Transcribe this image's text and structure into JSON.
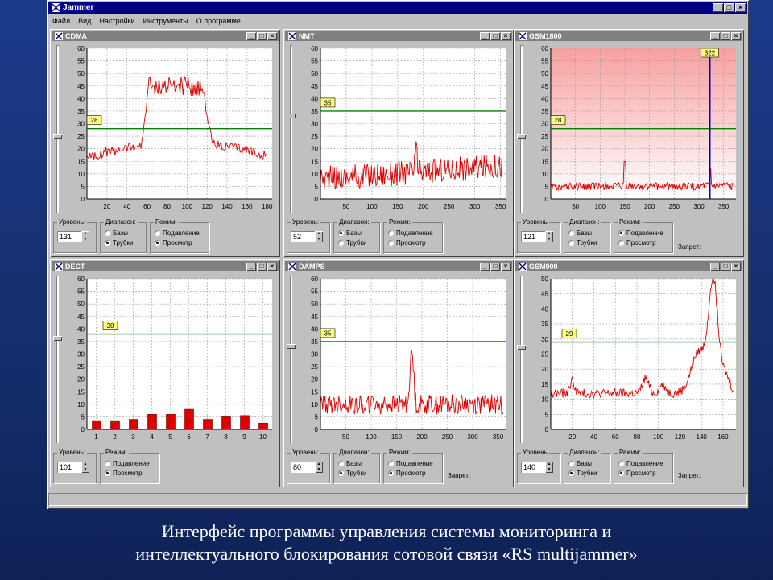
{
  "app": {
    "title": "Jammer"
  },
  "menu": [
    "Файл",
    "Вид",
    "Настройки",
    "Инструменты",
    "О программе"
  ],
  "labels": {
    "level": "Уровень:",
    "level_alt": "Уровень",
    "range": "Диапазон:",
    "mode": "Режим:",
    "bases": "Базы",
    "phones": "Трубки",
    "suppress": "Подавление",
    "view": "Просмотр",
    "ban": "Запрет:"
  },
  "colors": {
    "signal": "#dd0000",
    "threshold": "#008000",
    "alarm_bg": "#f7a0a0",
    "marker": "#0000cc"
  },
  "panels": [
    {
      "id": "cdma",
      "title": "CDMA",
      "level": "131",
      "range_sel": "phones",
      "mode_sel": "view",
      "chart_data": {
        "type": "line",
        "x_ticks": [
          "20",
          "40",
          "60",
          "80",
          "100",
          "120",
          "140",
          "160",
          "180"
        ],
        "y_ticks": [
          "0",
          "5",
          "10",
          "15",
          "20",
          "25",
          "30",
          "35",
          "40",
          "45",
          "50",
          "55",
          "60"
        ],
        "ylim": [
          0,
          60
        ],
        "xlim": [
          0,
          185
        ],
        "threshold": 28,
        "threshold_label": "28"
      }
    },
    {
      "id": "nmt",
      "title": "NMT",
      "level": "52",
      "range_sel": "bases",
      "mode_sel": "none",
      "chart_data": {
        "type": "line",
        "x_ticks": [
          "50",
          "100",
          "150",
          "200",
          "250",
          "300",
          "350"
        ],
        "y_ticks": [
          "0",
          "5",
          "10",
          "15",
          "20",
          "25",
          "30",
          "35",
          "40",
          "45",
          "50",
          "55",
          "60"
        ],
        "ylim": [
          0,
          60
        ],
        "xlim": [
          0,
          360
        ],
        "threshold": 35,
        "threshold_label": "35"
      }
    },
    {
      "id": "gsm1800",
      "title": "GSM1800",
      "level": "121",
      "range_sel": "none",
      "mode_sel": "suppress",
      "chart_data": {
        "type": "line",
        "x_ticks": [
          "50",
          "100",
          "150",
          "200",
          "250",
          "300",
          "350"
        ],
        "y_ticks": [
          "0",
          "5",
          "10",
          "15",
          "20",
          "25",
          "30",
          "35",
          "40",
          "45",
          "50",
          "55",
          "60"
        ],
        "ylim": [
          0,
          60
        ],
        "xlim": [
          0,
          375
        ],
        "threshold": 28,
        "threshold_label": "28",
        "marker_x": 322,
        "marker_label": "322"
      }
    },
    {
      "id": "dect",
      "title": "DECT",
      "level": "101",
      "mode_sel": "view",
      "chart_data": {
        "type": "bar",
        "categories": [
          "1",
          "2",
          "3",
          "4",
          "5",
          "6",
          "7",
          "8",
          "9",
          "10"
        ],
        "values": [
          3.5,
          3.5,
          4,
          6,
          6,
          8,
          4,
          5,
          5.5,
          2.5
        ],
        "y_ticks": [
          "0",
          "5",
          "10",
          "15",
          "20",
          "25",
          "30",
          "35",
          "40",
          "45",
          "50",
          "55",
          "60"
        ],
        "ylim": [
          0,
          60
        ],
        "threshold": 38,
        "threshold_label": "38"
      }
    },
    {
      "id": "damps",
      "title": "DAMPS",
      "level": "80",
      "range_sel": "phones",
      "mode_sel": "view",
      "chart_data": {
        "type": "line",
        "x_ticks": [
          "50",
          "100",
          "150",
          "200",
          "250",
          "300",
          "350"
        ],
        "y_ticks": [
          "0",
          "5",
          "10",
          "15",
          "20",
          "25",
          "30",
          "35",
          "40",
          "45",
          "50",
          "55",
          "60"
        ],
        "ylim": [
          0,
          60
        ],
        "xlim": [
          0,
          365
        ],
        "threshold": 35,
        "threshold_label": "35"
      }
    },
    {
      "id": "gsm900",
      "title": "GSM900",
      "level": "140",
      "range_sel": "phones",
      "mode_sel": "view",
      "chart_data": {
        "type": "line",
        "x_ticks": [
          "20",
          "40",
          "60",
          "80",
          "100",
          "120",
          "140",
          "160"
        ],
        "y_ticks": [
          "0",
          "5",
          "10",
          "15",
          "20",
          "25",
          "30",
          "35",
          "40",
          "45",
          "50"
        ],
        "ylim": [
          0,
          50
        ],
        "xlim": [
          0,
          172
        ],
        "threshold": 29,
        "threshold_label": "29"
      }
    }
  ],
  "caption": {
    "line1": "Интерфейс программы управления системы мониторинга и",
    "line2": "интеллектуального блокирования сотовой связи «RS multijammer»"
  }
}
